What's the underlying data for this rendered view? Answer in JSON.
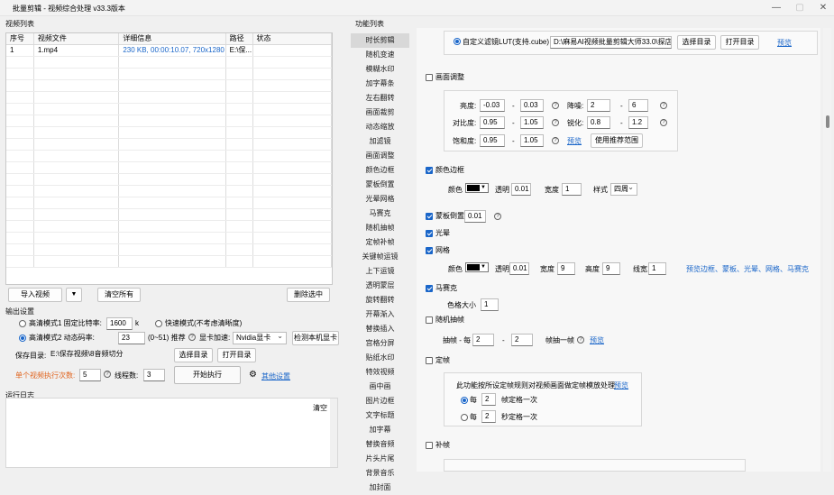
{
  "window": {
    "title": "批量剪辑 - 视频综合处理 v33.3版本",
    "minimize": "—",
    "maximize": "▢",
    "close": "✕"
  },
  "left": {
    "list_title": "视频列表",
    "table": {
      "headers": [
        "序号",
        "视频文件",
        "详细信息",
        "路径",
        "状态"
      ],
      "rows": [
        [
          "1",
          "1.mp4",
          "230 KB, 00:00:10.07, 720x1280",
          "E:\\保...",
          ""
        ]
      ]
    },
    "import_btn": "导入视频",
    "clear_btn": "清空所有",
    "delete_btn": "删除选中",
    "output_title": "输出设置",
    "mode1_label": "高清模式1 固定比特率:",
    "mode1_value": "1600",
    "mode1_unit": "k",
    "fast_mode_label": "快速模式(不考虑清晰度)",
    "mode2_label": "高清模式2 动态码率:",
    "mode2_value": "23",
    "mode2_range": "(0~51) 推荐",
    "gpu_label": "显卡加速:",
    "gpu_value": "Nvidia显卡",
    "detect_btn": "检测本机显卡",
    "save_label": "保存目录:",
    "save_path": "E:\\保存视频\\8音频切分",
    "choose_dir_btn": "选择目录",
    "open_dir_btn": "打开目录",
    "exec_times_label": "单个视频执行次数:",
    "exec_times_value": "5",
    "threads_label": "线程数:",
    "threads_value": "3",
    "start_btn": "开始执行",
    "other_settings": "其他设置",
    "log_title": "运行日志",
    "clear_log_btn": "清空"
  },
  "right": {
    "title": "功能列表",
    "nav": [
      "时长剪辑",
      "随机变速",
      "模糊水印",
      "加字幕条",
      "左右翻转",
      "画面裁剪",
      "动态缩放",
      "加滤镜",
      "画面调整",
      "颜色边框",
      "蒙板倒置",
      "光晕网格",
      "马赛克",
      "随机抽帧",
      "定帧补帧",
      "关键帧运镜",
      "上下运镜",
      "透明蒙层",
      "旋转翻转",
      "开幕渐入",
      "替换插入",
      "宫格分屏",
      "贴纸水印",
      "特效视频",
      "画中画",
      "图片边框",
      "文字标题",
      "加字幕",
      "替换音频",
      "片头片尾",
      "背景音乐",
      "加封面"
    ],
    "nav_active": 0,
    "lut": {
      "label": "自定义滤镜LUT(支持.cube)",
      "path": "D:\\麻易AI视频批量剪辑大师33.0\\探店[",
      "choose": "选择目录",
      "open": "打开目录",
      "preview": "预览"
    },
    "adjust": {
      "label": "画面调整",
      "brightness": "亮度:",
      "b_min": "-0.03",
      "b_max": "0.03",
      "denoise": "降噪:",
      "dn_min": "2",
      "dn_max": "6",
      "contrast": "对比度:",
      "c_min": "0.95",
      "c_max": "1.05",
      "sharpen": "锐化:",
      "s_min": "0.8",
      "s_max": "1.2",
      "saturation": "饱和度:",
      "sa_min": "0.95",
      "sa_max": "1.05",
      "preview": "预览",
      "recommend": "使用推荐范围",
      "dash": "-"
    },
    "border": {
      "label": "颜色边框",
      "color": "颜色",
      "alpha": "透明",
      "alpha_val": "0.01",
      "width": "宽度",
      "width_val": "1",
      "style": "样式",
      "style_val": "四周"
    },
    "mask": {
      "label": "蒙板倒置",
      "value": "0.01"
    },
    "halo": {
      "label": "光晕"
    },
    "grid": {
      "label": "网格",
      "color": "颜色",
      "alpha": "透明",
      "alpha_val": "0.01",
      "width": "宽度",
      "width_val": "9",
      "height": "高度",
      "height_val": "9",
      "line": "线宽",
      "line_val": "1",
      "preview": "预览边框、蒙板、光晕、网格、马赛克"
    },
    "mosaic": {
      "label": "马赛克",
      "size": "色格大小",
      "size_val": "1"
    },
    "drop": {
      "label": "随机抽帧",
      "every": "抽帧 - 每",
      "from": "2",
      "to": "2",
      "tail": "帧抽一帧",
      "preview": "预览"
    },
    "freeze": {
      "label": "定帧",
      "desc": "此功能按所设定帧规则对视频画面做定帧模放处理",
      "preview": "预览",
      "every": "每",
      "f1": "2",
      "f1_tail": "帧定格一次",
      "f2": "2",
      "f2_tail": "秒定格一次"
    },
    "fill": {
      "label": "补帧"
    }
  }
}
